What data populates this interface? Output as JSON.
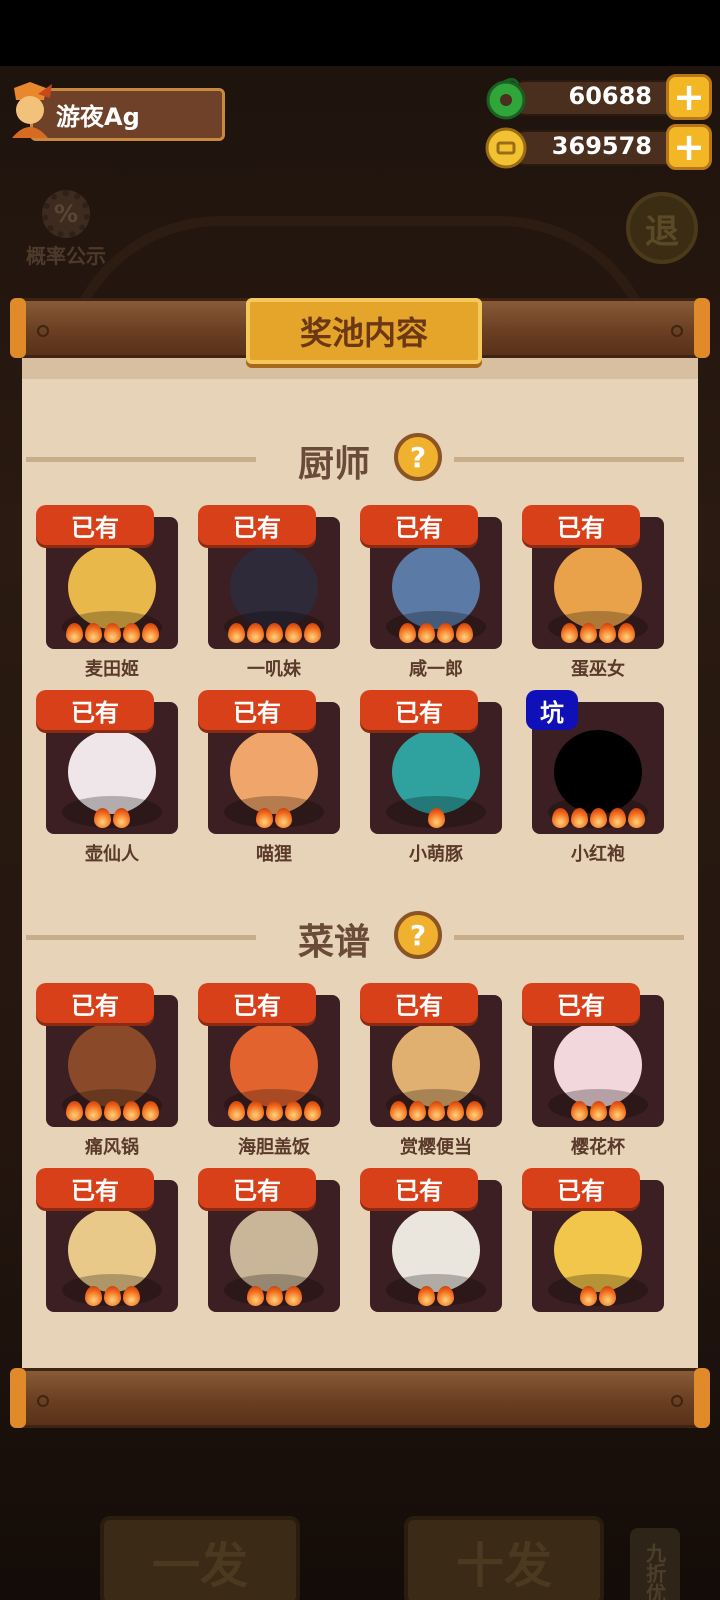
{
  "player": {
    "name": "游夜Ag"
  },
  "currencies": [
    {
      "name": "jade",
      "icon": "green-jade-icon",
      "value": "60688"
    },
    {
      "name": "coin",
      "icon": "gold-coin-icon",
      "value": "369578"
    }
  ],
  "toolbar": {
    "probability_label": "概率公示",
    "probability_icon_text": "%",
    "exit_label": "退"
  },
  "panel": {
    "title": "奖池内容",
    "sections": [
      {
        "title": "厨师",
        "items": [
          {
            "tag": "已有",
            "name": "麦田姬",
            "stars": 5
          },
          {
            "tag": "已有",
            "name": "一叽妹",
            "stars": 5
          },
          {
            "tag": "已有",
            "name": "咸一郎",
            "stars": 4
          },
          {
            "tag": "已有",
            "name": "蛋巫女",
            "stars": 4
          },
          {
            "tag": "已有",
            "name": "壶仙人",
            "stars": 2
          },
          {
            "tag": "已有",
            "name": "喵狸",
            "stars": 2
          },
          {
            "tag": "已有",
            "name": "小萌豚",
            "stars": 1
          },
          {
            "tag": "坑",
            "name": "小红袍",
            "stars": 5
          }
        ]
      },
      {
        "title": "菜谱",
        "items": [
          {
            "tag": "已有",
            "name": "痛风锅",
            "stars": 5
          },
          {
            "tag": "已有",
            "name": "海胆盖饭",
            "stars": 5
          },
          {
            "tag": "已有",
            "name": "赏樱便当",
            "stars": 5
          },
          {
            "tag": "已有",
            "name": "樱花杯",
            "stars": 3
          },
          {
            "tag": "已有",
            "name": "",
            "stars": 3
          },
          {
            "tag": "已有",
            "name": "",
            "stars": 3
          },
          {
            "tag": "已有",
            "name": "",
            "stars": 2
          },
          {
            "tag": "已有",
            "name": "",
            "stars": 2
          }
        ]
      }
    ]
  },
  "background": {
    "single_draw": "一发",
    "ten_draw": "十发",
    "discount": "九折优惠"
  },
  "colors": {
    "owned_tag": "#d8401a",
    "pit_tag": "#1010b8",
    "plus_button": "#f3b624",
    "title_plate": "#e5a42a"
  }
}
